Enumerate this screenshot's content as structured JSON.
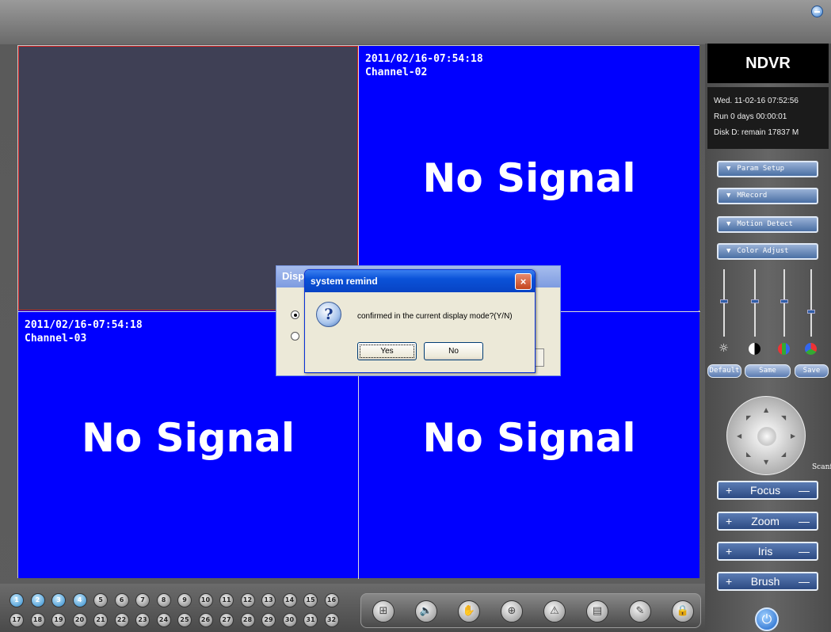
{
  "window": {
    "minimize_icon": "minimize-icon"
  },
  "video": {
    "cells": [
      {
        "timestamp": "",
        "channel": "",
        "status": ""
      },
      {
        "timestamp": "2011/02/16-07:54:18",
        "channel": "Channel-02",
        "status": "No  Signal"
      },
      {
        "timestamp": "2011/02/16-07:54:18",
        "channel": "Channel-03",
        "status": "No  Signal"
      },
      {
        "timestamp": "",
        "channel": "",
        "status": "No  Signal"
      }
    ]
  },
  "panel": {
    "brand": "NDVR",
    "status": {
      "line1": "Wed.   11-02-16  07:52:56",
      "line2": "Run 0 days   00:00:01",
      "line3": "Disk D: remain 17837 M"
    },
    "menu": [
      "Param Setup",
      "MRecord",
      "Motion Detect",
      "Color Adjust"
    ],
    "color_levels": [
      0.45,
      0.45,
      0.45,
      0.6
    ],
    "color_buttons": {
      "default": "Default",
      "same": "Same",
      "save": "Save"
    },
    "ptz": {
      "scan_label": "Scanf"
    },
    "lens": [
      {
        "plus": "+",
        "label": "Focus",
        "minus": "—"
      },
      {
        "plus": "+",
        "label": "Zoom",
        "minus": "—"
      },
      {
        "plus": "+",
        "label": "Iris",
        "minus": "—"
      },
      {
        "plus": "+",
        "label": "Brush",
        "minus": "—"
      }
    ]
  },
  "channels": {
    "row1": [
      "1",
      "2",
      "3",
      "4",
      "5",
      "6",
      "7",
      "8",
      "9",
      "10",
      "11",
      "12",
      "13",
      "14",
      "15",
      "16"
    ],
    "row2": [
      "17",
      "18",
      "19",
      "20",
      "21",
      "22",
      "23",
      "24",
      "25",
      "26",
      "27",
      "28",
      "29",
      "30",
      "31",
      "32"
    ],
    "active": [
      "1",
      "2",
      "3",
      "4"
    ]
  },
  "toolbar": [
    "layout-icon",
    "speaker-icon",
    "hand-icon",
    "globe-icon",
    "alarm-icon",
    "record-icon",
    "pen-icon",
    "lock-icon"
  ],
  "background_dialog": {
    "title": "Disp"
  },
  "dialog": {
    "title": "system remind",
    "close": "×",
    "icon": "?",
    "message": "confirmed in the current display mode?(Y/N)",
    "yes": "Yes",
    "no": "No"
  }
}
